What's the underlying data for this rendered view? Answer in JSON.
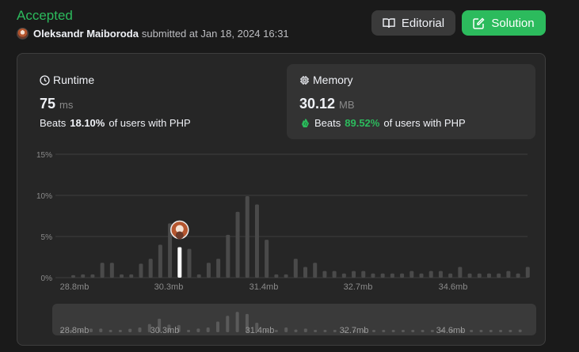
{
  "header": {
    "status": "Accepted",
    "author": "Oleksandr Maiboroda",
    "submitted_text": "submitted at Jan 18, 2024 16:31",
    "editorial_label": "Editorial",
    "solution_label": "Solution"
  },
  "runtime": {
    "title": "Runtime",
    "value": "75",
    "unit": "ms",
    "beats_label": "Beats",
    "beats_pct": "18.10%",
    "beats_suffix": "of users with PHP"
  },
  "memory": {
    "title": "Memory",
    "value": "30.12",
    "unit": "MB",
    "beats_label": "Beats",
    "beats_pct": "89.52%",
    "beats_suffix": "of users with PHP"
  },
  "colors": {
    "accent": "#2cbb5d",
    "bar": "#4a4a4a",
    "highlight": "#ffffff"
  },
  "chart_data": {
    "type": "bar",
    "xlabel_ticks": [
      "28.8mb",
      "30.3mb",
      "31.4mb",
      "32.7mb",
      "34.6mb"
    ],
    "y_ticks": [
      "15%",
      "10%",
      "5%",
      "0%"
    ],
    "ylim": [
      0,
      15
    ],
    "grid": true,
    "highlight_index": 11,
    "values": [
      0.3,
      0.4,
      0.4,
      1.8,
      1.8,
      0.4,
      0.4,
      1.7,
      2.3,
      4.0,
      6.6,
      3.7,
      3.5,
      0.4,
      1.8,
      2.3,
      5.2,
      8.0,
      9.9,
      8.9,
      4.6,
      0.4,
      0.4,
      2.3,
      1.3,
      1.8,
      0.8,
      0.8,
      0.5,
      0.8,
      0.8,
      0.5,
      0.5,
      0.5,
      0.5,
      0.8,
      0.5,
      0.8,
      0.8,
      0.5,
      1.3,
      0.5,
      0.5,
      0.5,
      0.5,
      0.8,
      0.5,
      1.3
    ]
  }
}
